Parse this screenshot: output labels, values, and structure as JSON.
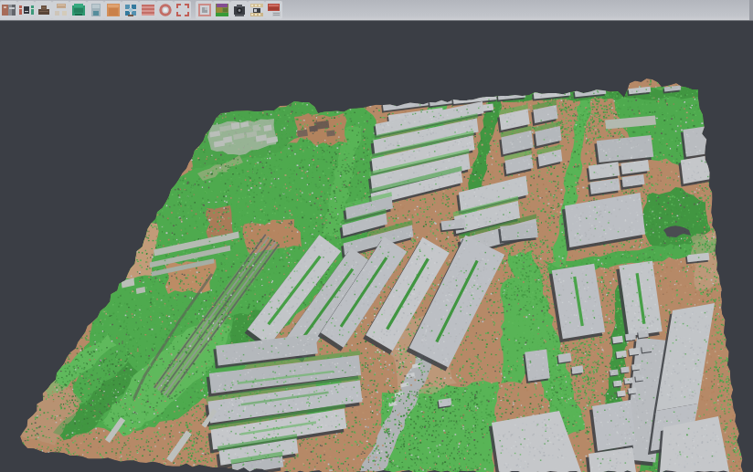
{
  "window": {
    "kind": "3d-point-cloud-viewer"
  },
  "toolbar": {
    "background_color": "#b8bbc2",
    "icons": [
      {
        "name": "open-project-icon"
      },
      {
        "name": "align-photos-icon"
      },
      {
        "name": "build-mesh-icon"
      },
      {
        "name": "build-tiled-model-icon"
      },
      {
        "name": "textured-model-icon"
      },
      {
        "name": "dense-cloud-icon"
      },
      {
        "name": "orthomosaic-icon"
      },
      {
        "name": "update-icon"
      },
      {
        "name": "dem-icon"
      },
      {
        "name": "circle-select-icon"
      },
      {
        "name": "crop-region-icon"
      },
      {
        "name": "clip-box-icon"
      },
      {
        "name": "classified-raster-icon"
      },
      {
        "name": "camera-icon"
      },
      {
        "name": "filmstrip-icon"
      },
      {
        "name": "screenshot-icon"
      }
    ]
  },
  "viewport": {
    "background_color": "#3b3e46",
    "content": "oblique 3d view of a classified point cloud of an industrial district",
    "point_classes": [
      {
        "name": "ground",
        "color": "#c28152"
      },
      {
        "name": "vegetation",
        "color": "#2eb02e"
      },
      {
        "name": "building",
        "color": "#c7cbd1"
      }
    ]
  }
}
